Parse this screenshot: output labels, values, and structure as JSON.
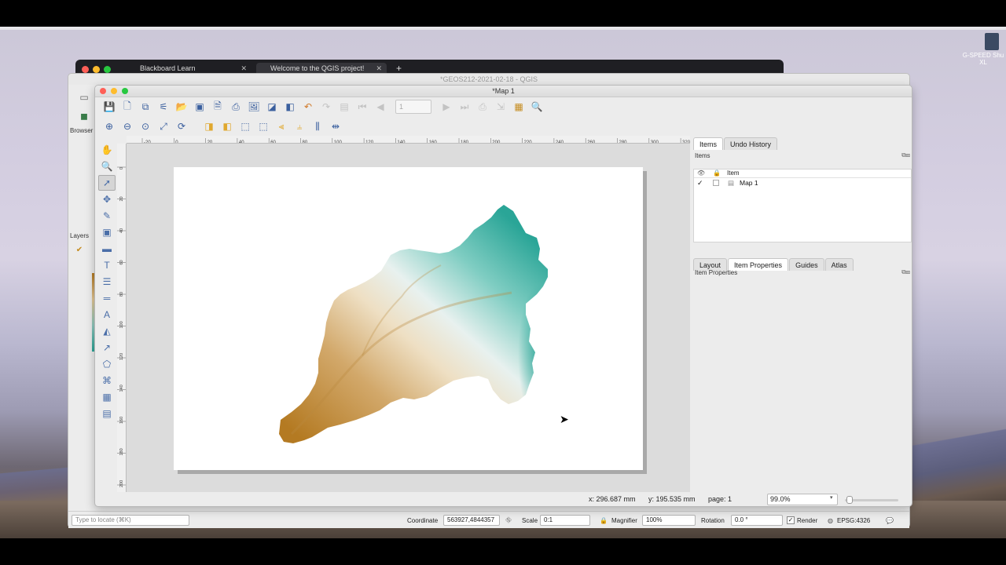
{
  "browser": {
    "tabs": [
      {
        "label": "Blackboard Learn"
      },
      {
        "label": "Welcome to the QGIS project!"
      }
    ],
    "new_tab": "+"
  },
  "desktop": {
    "icon_label": "G-SPEED Shu XL"
  },
  "qgis": {
    "title": "*GEOS212-2021-02-18 - QGIS",
    "browser_label": "Browser",
    "layers_label": "Layers",
    "locate_placeholder": "Type to locate (⌘K)",
    "coordinate_label": "Coordinate",
    "coordinate_value": "563927,4844357",
    "scale_label": "Scale",
    "scale_value": "0:1",
    "magnifier_label": "Magnifier",
    "magnifier_value": "100%",
    "rotation_label": "Rotation",
    "rotation_value": "0.0 °",
    "render_label": "Render",
    "crs": "EPSG:4326"
  },
  "layout": {
    "title": "*Map 1",
    "page_input": "1",
    "ruler_top_labels": [
      "-20",
      "0",
      "20",
      "40",
      "60",
      "80",
      "100",
      "120",
      "140",
      "160",
      "180",
      "200",
      "220",
      "240",
      "260",
      "280",
      "300",
      "320"
    ],
    "ruler_left_labels": [
      "0",
      "20",
      "40",
      "60",
      "80",
      "100",
      "120",
      "140",
      "160",
      "180",
      "200",
      "220"
    ],
    "status": {
      "x": "x: 296.687 mm",
      "y": "y: 195.535 mm",
      "page": "page: 1",
      "zoom": "99.0%"
    }
  },
  "items_panel": {
    "tabs": [
      "Items",
      "Undo History"
    ],
    "active_tab": "Items",
    "header": "Items",
    "column": "Item",
    "items": [
      {
        "name": "Map 1",
        "visible": true,
        "locked": false
      }
    ]
  },
  "properties_panel": {
    "tabs": [
      "Layout",
      "Item Properties",
      "Guides",
      "Atlas"
    ],
    "active_tab": "Item Properties",
    "header": "Item Properties"
  },
  "colors": {
    "dem_low": "#b47a22",
    "dem_mid": "#f3ead7",
    "dem_high": "#2aa597"
  }
}
